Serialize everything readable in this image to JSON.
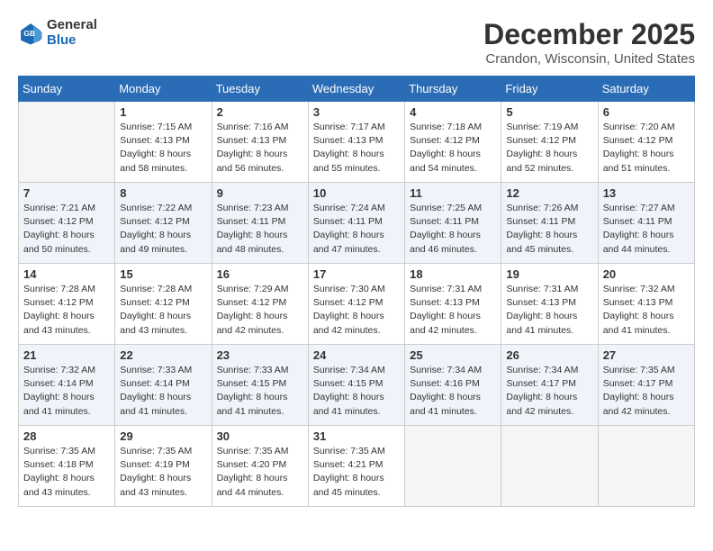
{
  "header": {
    "logo": {
      "general": "General",
      "blue": "Blue"
    },
    "title": "December 2025",
    "location": "Crandon, Wisconsin, United States"
  },
  "days_of_week": [
    "Sunday",
    "Monday",
    "Tuesday",
    "Wednesday",
    "Thursday",
    "Friday",
    "Saturday"
  ],
  "weeks": [
    [
      {
        "day": "",
        "empty": true
      },
      {
        "day": "1",
        "sunrise": "7:15 AM",
        "sunset": "4:13 PM",
        "daylight": "8 hours and 58 minutes."
      },
      {
        "day": "2",
        "sunrise": "7:16 AM",
        "sunset": "4:13 PM",
        "daylight": "8 hours and 56 minutes."
      },
      {
        "day": "3",
        "sunrise": "7:17 AM",
        "sunset": "4:13 PM",
        "daylight": "8 hours and 55 minutes."
      },
      {
        "day": "4",
        "sunrise": "7:18 AM",
        "sunset": "4:12 PM",
        "daylight": "8 hours and 54 minutes."
      },
      {
        "day": "5",
        "sunrise": "7:19 AM",
        "sunset": "4:12 PM",
        "daylight": "8 hours and 52 minutes."
      },
      {
        "day": "6",
        "sunrise": "7:20 AM",
        "sunset": "4:12 PM",
        "daylight": "8 hours and 51 minutes."
      }
    ],
    [
      {
        "day": "7",
        "sunrise": "7:21 AM",
        "sunset": "4:12 PM",
        "daylight": "8 hours and 50 minutes."
      },
      {
        "day": "8",
        "sunrise": "7:22 AM",
        "sunset": "4:12 PM",
        "daylight": "8 hours and 49 minutes."
      },
      {
        "day": "9",
        "sunrise": "7:23 AM",
        "sunset": "4:11 PM",
        "daylight": "8 hours and 48 minutes."
      },
      {
        "day": "10",
        "sunrise": "7:24 AM",
        "sunset": "4:11 PM",
        "daylight": "8 hours and 47 minutes."
      },
      {
        "day": "11",
        "sunrise": "7:25 AM",
        "sunset": "4:11 PM",
        "daylight": "8 hours and 46 minutes."
      },
      {
        "day": "12",
        "sunrise": "7:26 AM",
        "sunset": "4:11 PM",
        "daylight": "8 hours and 45 minutes."
      },
      {
        "day": "13",
        "sunrise": "7:27 AM",
        "sunset": "4:11 PM",
        "daylight": "8 hours and 44 minutes."
      }
    ],
    [
      {
        "day": "14",
        "sunrise": "7:28 AM",
        "sunset": "4:12 PM",
        "daylight": "8 hours and 43 minutes."
      },
      {
        "day": "15",
        "sunrise": "7:28 AM",
        "sunset": "4:12 PM",
        "daylight": "8 hours and 43 minutes."
      },
      {
        "day": "16",
        "sunrise": "7:29 AM",
        "sunset": "4:12 PM",
        "daylight": "8 hours and 42 minutes."
      },
      {
        "day": "17",
        "sunrise": "7:30 AM",
        "sunset": "4:12 PM",
        "daylight": "8 hours and 42 minutes."
      },
      {
        "day": "18",
        "sunrise": "7:31 AM",
        "sunset": "4:13 PM",
        "daylight": "8 hours and 42 minutes."
      },
      {
        "day": "19",
        "sunrise": "7:31 AM",
        "sunset": "4:13 PM",
        "daylight": "8 hours and 41 minutes."
      },
      {
        "day": "20",
        "sunrise": "7:32 AM",
        "sunset": "4:13 PM",
        "daylight": "8 hours and 41 minutes."
      }
    ],
    [
      {
        "day": "21",
        "sunrise": "7:32 AM",
        "sunset": "4:14 PM",
        "daylight": "8 hours and 41 minutes."
      },
      {
        "day": "22",
        "sunrise": "7:33 AM",
        "sunset": "4:14 PM",
        "daylight": "8 hours and 41 minutes."
      },
      {
        "day": "23",
        "sunrise": "7:33 AM",
        "sunset": "4:15 PM",
        "daylight": "8 hours and 41 minutes."
      },
      {
        "day": "24",
        "sunrise": "7:34 AM",
        "sunset": "4:15 PM",
        "daylight": "8 hours and 41 minutes."
      },
      {
        "day": "25",
        "sunrise": "7:34 AM",
        "sunset": "4:16 PM",
        "daylight": "8 hours and 41 minutes."
      },
      {
        "day": "26",
        "sunrise": "7:34 AM",
        "sunset": "4:17 PM",
        "daylight": "8 hours and 42 minutes."
      },
      {
        "day": "27",
        "sunrise": "7:35 AM",
        "sunset": "4:17 PM",
        "daylight": "8 hours and 42 minutes."
      }
    ],
    [
      {
        "day": "28",
        "sunrise": "7:35 AM",
        "sunset": "4:18 PM",
        "daylight": "8 hours and 43 minutes."
      },
      {
        "day": "29",
        "sunrise": "7:35 AM",
        "sunset": "4:19 PM",
        "daylight": "8 hours and 43 minutes."
      },
      {
        "day": "30",
        "sunrise": "7:35 AM",
        "sunset": "4:20 PM",
        "daylight": "8 hours and 44 minutes."
      },
      {
        "day": "31",
        "sunrise": "7:35 AM",
        "sunset": "4:21 PM",
        "daylight": "8 hours and 45 minutes."
      },
      {
        "day": "",
        "empty": true
      },
      {
        "day": "",
        "empty": true
      },
      {
        "day": "",
        "empty": true
      }
    ]
  ]
}
